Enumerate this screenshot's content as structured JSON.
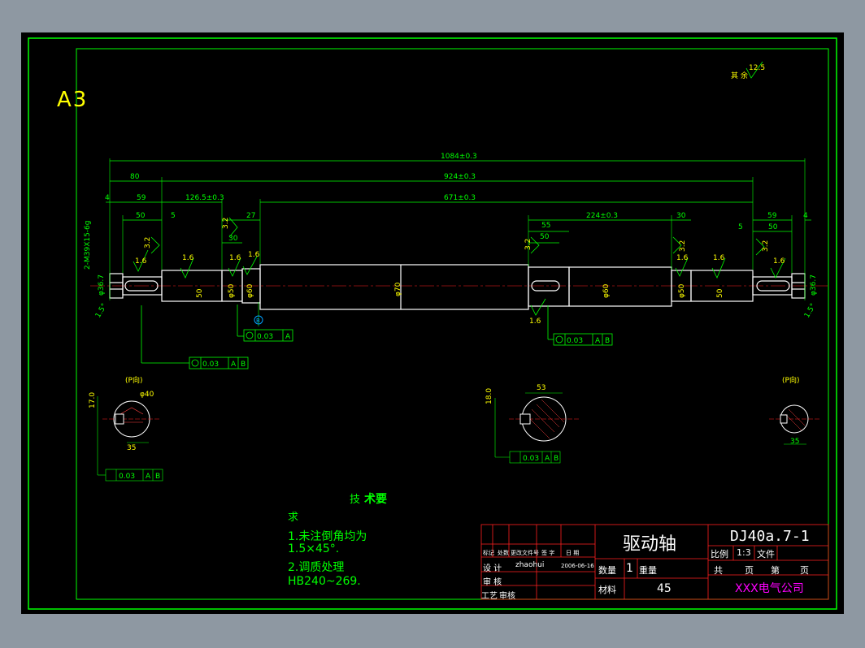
{
  "sheet": {
    "size_label": "A3"
  },
  "surface_finish_note": {
    "label": "其 余",
    "value": "12.5"
  },
  "dimensions": {
    "overall": "1084±0.3",
    "d80": "80",
    "d924": "924±0.3",
    "d4_left": "4",
    "d59_left": "59",
    "d126": "126.5±0.3",
    "d671": "671±0.3",
    "d50_left": "50",
    "d5_left": "5",
    "d27": "27",
    "d30_left": "30",
    "d55": "55",
    "d50_mid": "50",
    "d224": "224±0.3",
    "d30_right": "30",
    "d59_right": "59",
    "d4_right": "4",
    "d5_right": "5",
    "d50_right": "50",
    "thread": "2-M39X15-6g",
    "dia_left_end": "φ36.7",
    "dia_left_journal": "50",
    "dia_50": "φ50",
    "dia_60": "φ60",
    "dia_70": "φ70",
    "dia_60_right": "φ60",
    "dia_50_right": "φ50",
    "dia_right_journal": "50",
    "dia_right_end": "φ36.7",
    "chamfer_left": "1.5°",
    "chamfer_right": "1.5°",
    "rough_32": "3.2",
    "rough_16": "1.6",
    "datum_b": "B"
  },
  "tolerances": {
    "runout_a": "0.03",
    "datum_a": "A",
    "datum_b": "B",
    "runout_ab": "0.03"
  },
  "sections": {
    "left": {
      "label": "(P向)",
      "dim1": "17.0",
      "dim2": "φ40",
      "dim3": "35",
      "tol": "0.03"
    },
    "mid": {
      "label": "",
      "dim1": "18.0",
      "dim2": "53",
      "tol": "0.03"
    },
    "right": {
      "label": "(P向)",
      "dim3": "35"
    }
  },
  "notes": {
    "title_a": "技",
    "title_b": "术要",
    "title_c": "求",
    "line1": "1.未注倒角均为",
    "line2": "1.5×45°.",
    "line3": "2.调质处理",
    "line4": "HB240~269."
  },
  "title_block": {
    "part_name": "驱动轴",
    "drawing_no": "DJ40a.7-1",
    "row1": [
      "标记",
      "处数",
      "更改文件号",
      "签 字",
      "日 期"
    ],
    "designer_label": "设  计",
    "designer": "zhaohui",
    "date": "2006-06-16",
    "check_label": "审  核",
    "process_label": "工艺",
    "process_check": "审核",
    "qty_label": "数量",
    "qty": "1",
    "weight_label": "重量",
    "material_label": "材料",
    "material": "45",
    "scale_label": "比例",
    "scale": "1:3",
    "file_label": "文件",
    "sheets": [
      "共",
      "页",
      "第",
      "页"
    ],
    "company": "XXX电气公司"
  },
  "colors": {
    "background": "#000000",
    "frame": "#00ff00",
    "dimension": "#00ff00",
    "outline": "#ffffff",
    "highlight": "#ffff00",
    "company": "#ff00ff"
  }
}
